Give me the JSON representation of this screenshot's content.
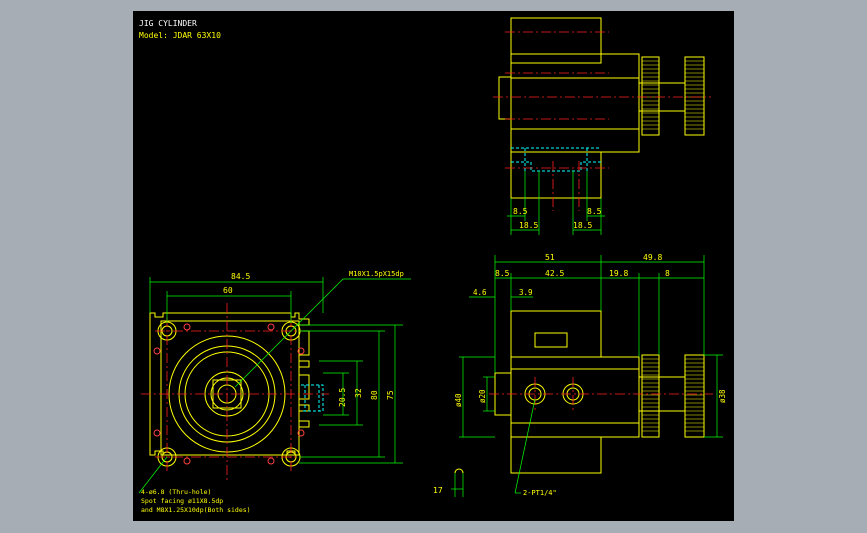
{
  "header": {
    "title": "JIG CYLINDER",
    "model": "Model: JDAR 63X10"
  },
  "colors": {
    "background": "#a7adb5",
    "sheet": "#000000",
    "outline": "#ffff00",
    "dimension": "#00ff00",
    "centerline": "#ff2020",
    "hidden": "#00ffff",
    "detail": "#ff4040"
  },
  "dims": {
    "top_left_85": "8.5",
    "top_right_85": "8.5",
    "top_left_185": "18.5",
    "top_right_185": "18.5",
    "front_845": "84.5",
    "front_60": "60",
    "front_205": "20.5",
    "front_32": "32",
    "front_80": "80",
    "front_75": "75",
    "side_51": "51",
    "side_498": "49.8",
    "side_85": "8.5",
    "side_425": "42.5",
    "side_198": "19.8",
    "side_8": "8",
    "side_46": "4.6",
    "side_39": "3.9",
    "side_phi20": "ø20",
    "side_phi40": "ø40",
    "side_phi38": "ø38",
    "side_17": "17"
  },
  "notes": {
    "thread": "M10X1.5pX15dp",
    "holes_1": "4-ø6.8 (Thru-hole)",
    "holes_2": "Spot facing ø11X8.5dp",
    "holes_3": "and M8X1.25X10dp(Both sides)",
    "port": "2-PT1/4\""
  }
}
